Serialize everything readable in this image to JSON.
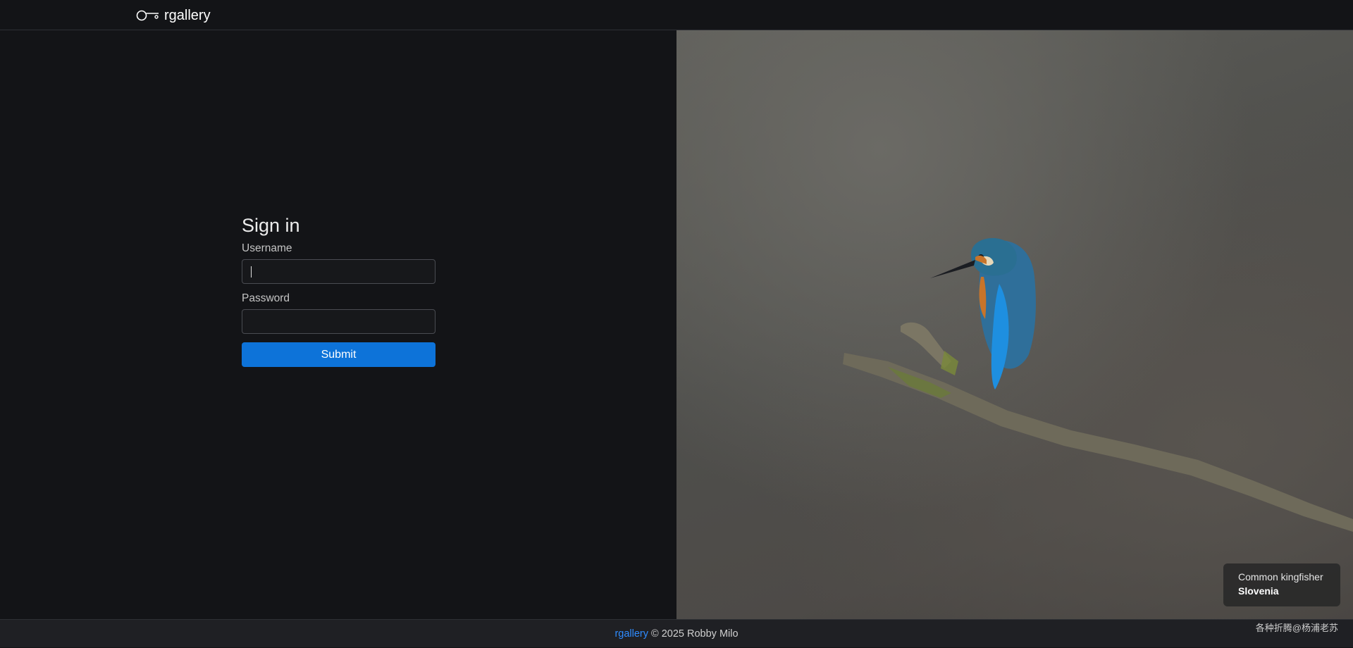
{
  "header": {
    "brand": "rgallery"
  },
  "signin": {
    "title": "Sign in",
    "username_label": "Username",
    "password_label": "Password",
    "username_value": "",
    "password_value": "",
    "submit_label": "Submit"
  },
  "photo": {
    "caption_name": "Common kingfisher",
    "caption_place": "Slovenia"
  },
  "footer": {
    "link": "rgallery",
    "text": "© 2025 Robby Milo"
  },
  "watermark": "各种折腾@杨浦老苏",
  "colors": {
    "accent": "#0d73d9",
    "link": "#2f8cff",
    "background": "#131417"
  }
}
